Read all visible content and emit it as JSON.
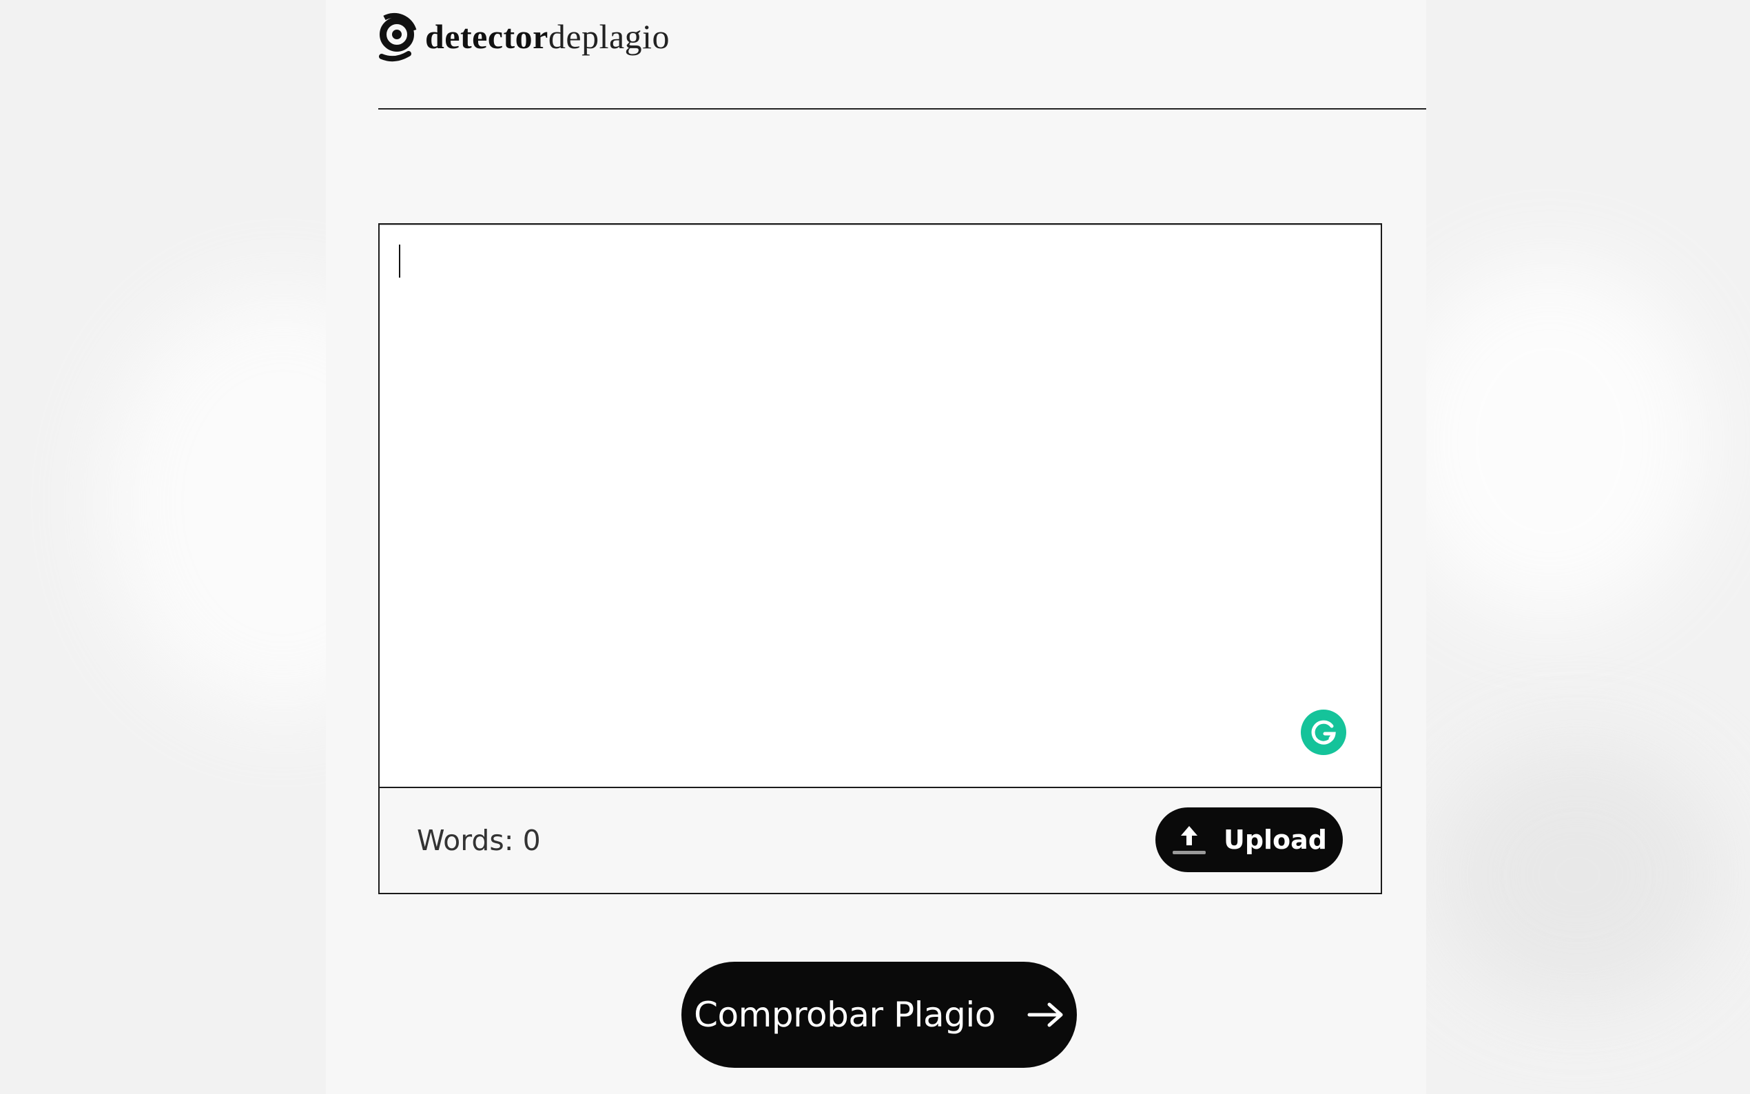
{
  "brand": {
    "name_bold": "detector",
    "name_light": "deplagio",
    "logo_icon": "magnifier-logo-icon"
  },
  "editor": {
    "text_value": "",
    "placeholder": "",
    "grammarly_icon": "grammarly-icon"
  },
  "footer": {
    "word_count": "Words: 0",
    "upload_label": "Upload",
    "upload_icon": "upload-icon"
  },
  "primary_action": {
    "label": "Comprobar Plagio",
    "icon": "arrow-right-icon"
  },
  "colors": {
    "accent_black": "#0a0a0a",
    "grammarly_green": "#15c39a",
    "page_background": "#f7f7f7"
  }
}
